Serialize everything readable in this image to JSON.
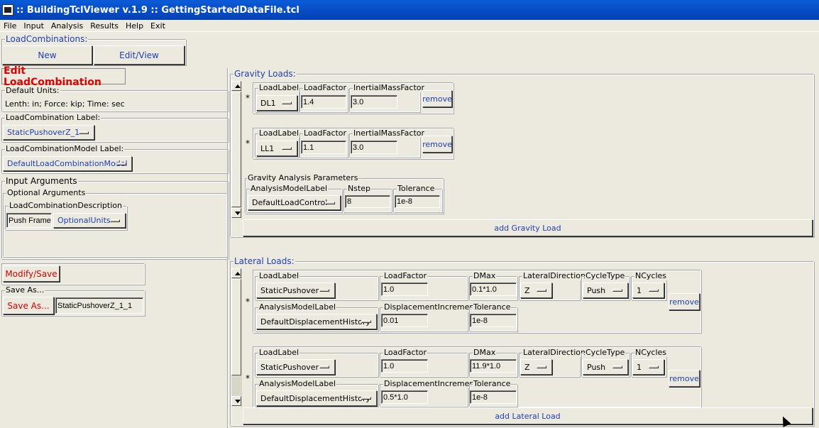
{
  "window": {
    "title": ":: BuildingTclViewer v.1.9 :: GettingStartedDataFile.tcl"
  },
  "menu": [
    "File",
    "Input",
    "Analysis",
    "Results",
    "Help",
    "Exit"
  ],
  "load_combinations": {
    "label": "LoadCombinations:",
    "new": "New",
    "edit_view": "Edit/View"
  },
  "edit": {
    "title": "Edit LoadCombination",
    "default_units_label": "Default Units:",
    "default_units_text": "Lenth: in; Force: kip; Time: sec",
    "combo_label_label": "LoadCombination Label:",
    "combo_label_value": "StaticPushoverZ_1",
    "model_label_label": "LoadCombinationModel Label:",
    "model_label_value": "DefaultLoadCombinationModel",
    "input_arguments": "Input Arguments",
    "optional_arguments": "Optional Arguments",
    "description_label": "LoadCombinationDescription",
    "description_value": "Push Frame t",
    "optional_units": "OptionalUnits",
    "modify_save": "Modify/Save",
    "save_as_label": "Save As...",
    "save_as_button": "Save As...",
    "save_as_value": "StaticPushoverZ_1_1"
  },
  "gravity": {
    "label": "Gravity Loads:",
    "star": "*",
    "rows": [
      {
        "load_label_title": "LoadLabel",
        "load_label": "DL1",
        "load_factor_title": "LoadFactor",
        "load_factor": "1.4",
        "inertial_title": "InertialMassFactor",
        "inertial": "3.0",
        "remove": "remove"
      },
      {
        "load_label_title": "LoadLabel",
        "load_label": "LL1",
        "load_factor_title": "LoadFactor",
        "load_factor": "1.1",
        "inertial_title": "InertialMassFactor",
        "inertial": "3.0",
        "remove": "remove"
      }
    ],
    "params": {
      "label": "Gravity Analysis Parameters",
      "model_title": "AnalysisModelLabel",
      "model": "DefaultLoadControl",
      "nstep_title": "Nstep",
      "nstep": "8",
      "tol_title": "Tolerance",
      "tol": "1e-8"
    },
    "add": "add Gravity Load"
  },
  "lateral": {
    "label": "Lateral Loads:",
    "star": "*",
    "rows": [
      {
        "load_label_title": "LoadLabel",
        "load_label": "StaticPushover",
        "load_factor_title": "LoadFactor",
        "load_factor": "1.0",
        "dmax_title": "DMax",
        "dmax": "0.1*1.0",
        "dir_title": "LateralDirection",
        "dir": "Z",
        "cycle_title": "CycleType",
        "cycle": "Push",
        "ncycles_title": "NCycles",
        "ncycles": "1",
        "model_title": "AnalysisModelLabel",
        "model": "DefaultDisplacementHistory",
        "disp_title": "DisplacementIncrement",
        "disp": "0.01",
        "tol_title": "Tolerance",
        "tol": "1e-8",
        "remove": "remove"
      },
      {
        "load_label_title": "LoadLabel",
        "load_label": "StaticPushover",
        "load_factor_title": "LoadFactor",
        "load_factor": "1.0",
        "dmax_title": "DMax",
        "dmax": "11.9*1.0",
        "dir_title": "LateralDirection",
        "dir": "Z",
        "cycle_title": "CycleType",
        "cycle": "Push",
        "ncycles_title": "NCycles",
        "ncycles": "1",
        "model_title": "AnalysisModelLabel",
        "model": "DefaultDisplacementHistory",
        "disp_title": "DisplacementIncrement",
        "disp": "0.5*1.0",
        "tol_title": "Tolerance",
        "tol": "1e-8",
        "remove": "remove"
      }
    ],
    "add": "add Lateral Load"
  }
}
